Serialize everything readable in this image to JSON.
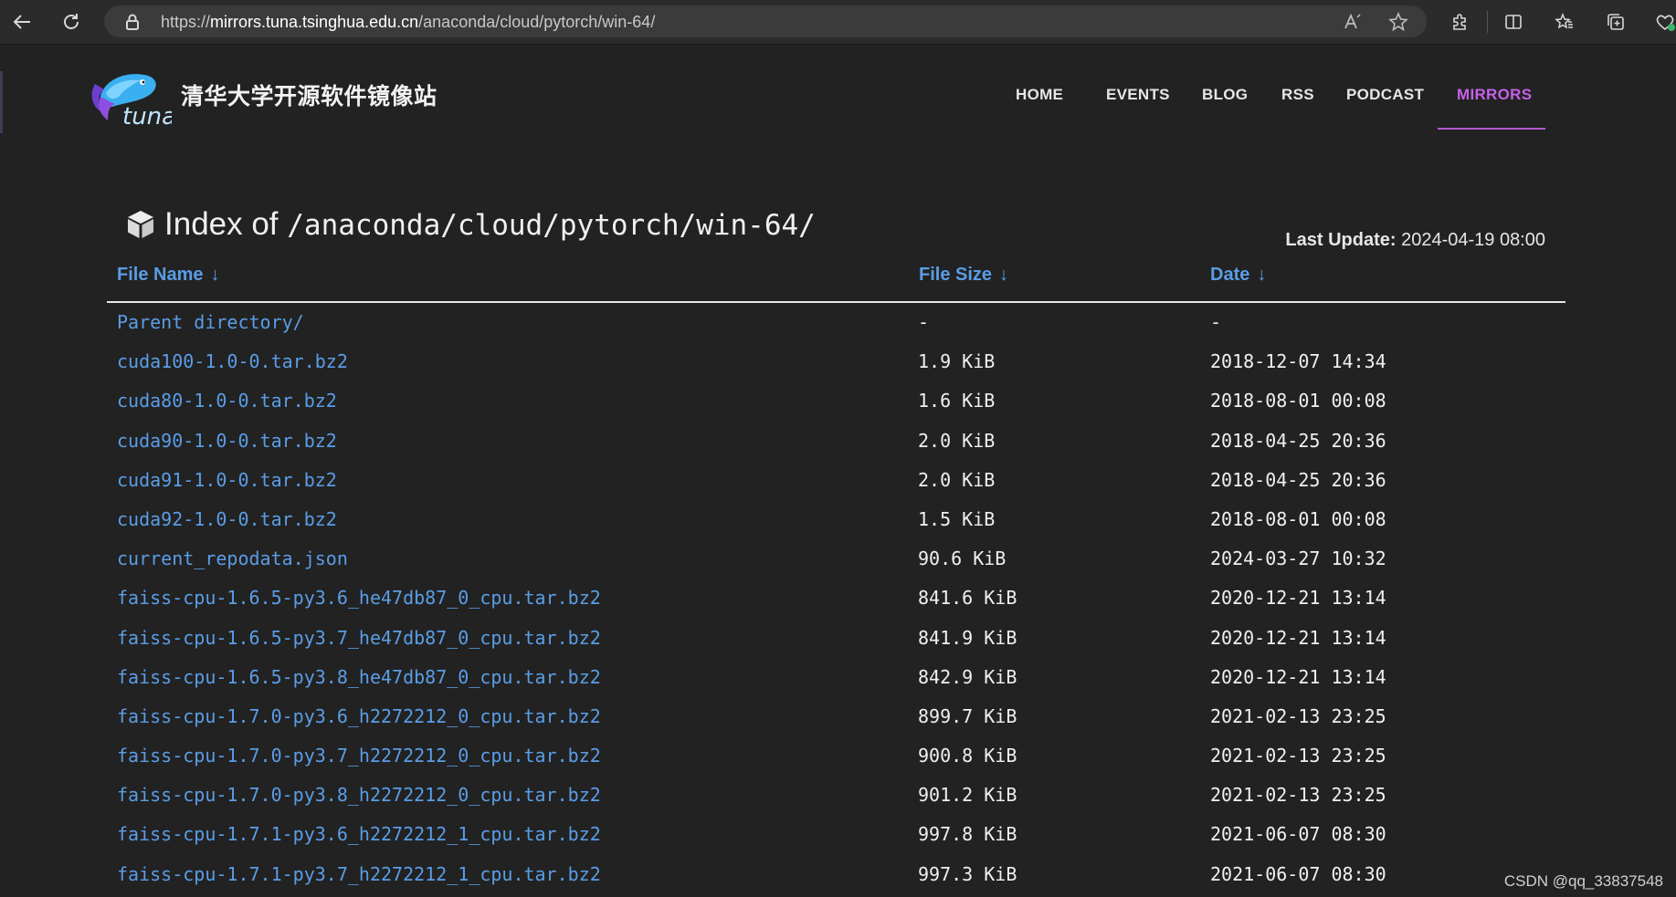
{
  "browser": {
    "url_prefix": "https://",
    "url_host": "mirrors.tuna.tsinghua.edu.cn",
    "url_path": "/anaconda/cloud/pytorch/win-64/"
  },
  "site": {
    "logo_text": "tuna",
    "title": "清华大学开源软件镜像站",
    "nav": [
      "HOME",
      "EVENTS",
      "BLOG",
      "RSS",
      "PODCAST",
      "MIRRORS"
    ],
    "active_nav": "MIRRORS"
  },
  "index": {
    "title_prefix": "Index of ",
    "title_path": "/anaconda/cloud/pytorch/win-64/",
    "last_update_label": "Last Update:",
    "last_update_value": "2024-04-19 08:00"
  },
  "table": {
    "headers": [
      "File Name",
      "File Size",
      "Date"
    ],
    "sort_arrow": "↓",
    "rows": [
      {
        "name": "Parent directory/",
        "size": "-",
        "date": "-"
      },
      {
        "name": "cuda100-1.0-0.tar.bz2",
        "size": "1.9 KiB",
        "date": "2018-12-07 14:34"
      },
      {
        "name": "cuda80-1.0-0.tar.bz2",
        "size": "1.6 KiB",
        "date": "2018-08-01 00:08"
      },
      {
        "name": "cuda90-1.0-0.tar.bz2",
        "size": "2.0 KiB",
        "date": "2018-04-25 20:36"
      },
      {
        "name": "cuda91-1.0-0.tar.bz2",
        "size": "2.0 KiB",
        "date": "2018-04-25 20:36"
      },
      {
        "name": "cuda92-1.0-0.tar.bz2",
        "size": "1.5 KiB",
        "date": "2018-08-01 00:08"
      },
      {
        "name": "current_repodata.json",
        "size": "90.6 KiB",
        "date": "2024-03-27 10:32"
      },
      {
        "name": "faiss-cpu-1.6.5-py3.6_he47db87_0_cpu.tar.bz2",
        "size": "841.6 KiB",
        "date": "2020-12-21 13:14"
      },
      {
        "name": "faiss-cpu-1.6.5-py3.7_he47db87_0_cpu.tar.bz2",
        "size": "841.9 KiB",
        "date": "2020-12-21 13:14"
      },
      {
        "name": "faiss-cpu-1.6.5-py3.8_he47db87_0_cpu.tar.bz2",
        "size": "842.9 KiB",
        "date": "2020-12-21 13:14"
      },
      {
        "name": "faiss-cpu-1.7.0-py3.6_h2272212_0_cpu.tar.bz2",
        "size": "899.7 KiB",
        "date": "2021-02-13 23:25"
      },
      {
        "name": "faiss-cpu-1.7.0-py3.7_h2272212_0_cpu.tar.bz2",
        "size": "900.8 KiB",
        "date": "2021-02-13 23:25"
      },
      {
        "name": "faiss-cpu-1.7.0-py3.8_h2272212_0_cpu.tar.bz2",
        "size": "901.2 KiB",
        "date": "2021-02-13 23:25"
      },
      {
        "name": "faiss-cpu-1.7.1-py3.6_h2272212_1_cpu.tar.bz2",
        "size": "997.8 KiB",
        "date": "2021-06-07 08:30"
      },
      {
        "name": "faiss-cpu-1.7.1-py3.7_h2272212_1_cpu.tar.bz2",
        "size": "997.3 KiB",
        "date": "2021-06-07 08:30"
      }
    ]
  },
  "watermark": "CSDN @qq_33837548",
  "icons": {
    "back": "back-arrow-icon",
    "refresh": "refresh-icon",
    "lock": "lock-icon",
    "read_aloud": "read-aloud-icon",
    "favorite": "star-icon",
    "extensions": "puzzle-icon",
    "split": "split-screen-icon",
    "favorites": "favorites-icon",
    "collections": "collections-icon",
    "profile": "profile-icon",
    "package": "box-icon"
  },
  "colors": {
    "background": "#222222",
    "link": "#5a9de6",
    "active_nav": "#c561e6"
  }
}
